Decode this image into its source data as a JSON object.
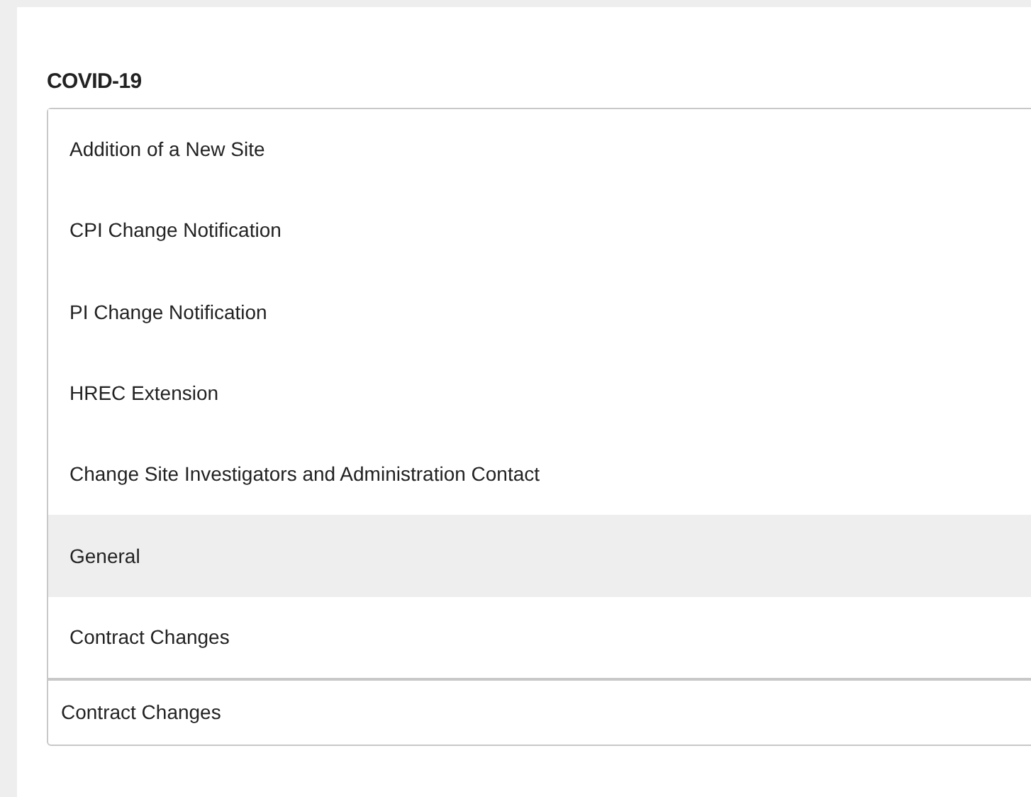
{
  "field_label": "COVID-19",
  "options": [
    {
      "label": "Addition of a New Site",
      "selected": false
    },
    {
      "label": "CPI Change Notification",
      "selected": false
    },
    {
      "label": "PI Change Notification",
      "selected": false
    },
    {
      "label": "HREC Extension",
      "selected": false
    },
    {
      "label": "Change Site Investigators and Administration Contact",
      "selected": false
    },
    {
      "label": "General",
      "selected": true
    },
    {
      "label": "Contract Changes",
      "selected": false
    }
  ],
  "select": {
    "value": "Contract Changes"
  }
}
